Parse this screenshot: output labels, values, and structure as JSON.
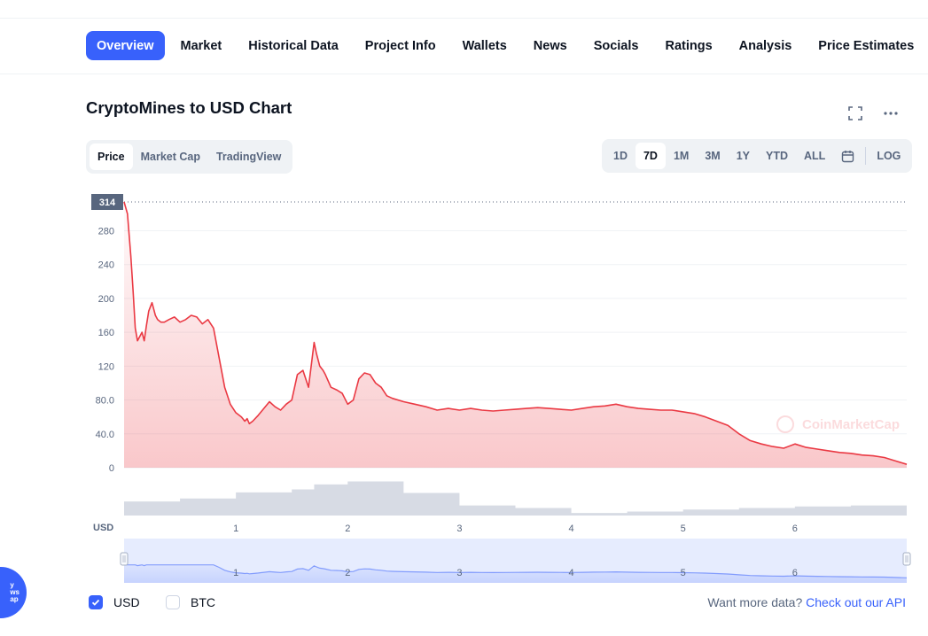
{
  "nav": {
    "tabs": [
      {
        "label": "Overview",
        "active": true
      },
      {
        "label": "Market"
      },
      {
        "label": "Historical Data"
      },
      {
        "label": "Project Info"
      },
      {
        "label": "Wallets"
      },
      {
        "label": "News"
      },
      {
        "label": "Socials"
      },
      {
        "label": "Ratings"
      },
      {
        "label": "Analysis"
      },
      {
        "label": "Price Estimates"
      }
    ]
  },
  "chart_header": {
    "title": "CryptoMines to USD Chart",
    "fullscreen_icon": "fullscreen-icon",
    "more_icon": "more-icon"
  },
  "chart_type_tabs": [
    {
      "label": "Price",
      "active": true
    },
    {
      "label": "Market Cap"
    },
    {
      "label": "TradingView"
    }
  ],
  "range_tabs": [
    {
      "label": "1D"
    },
    {
      "label": "7D",
      "active": true
    },
    {
      "label": "1M"
    },
    {
      "label": "3M"
    },
    {
      "label": "1Y"
    },
    {
      "label": "YTD"
    },
    {
      "label": "ALL"
    }
  ],
  "calendar_icon": "calendar-icon",
  "log_label": "LOG",
  "watermark": "CoinMarketCap",
  "colors": {
    "accent": "#3861fb",
    "price_line": "#ea3943",
    "volume": "#cfd6e4",
    "text_muted": "#58667e"
  },
  "chart_data": {
    "type": "line",
    "currency_label": "USD",
    "current_price_tag": "314",
    "ylim": [
      0,
      314
    ],
    "yticks": [
      0,
      40,
      80,
      120,
      160,
      200,
      240,
      280
    ],
    "ytick_labels": [
      "0",
      "40.0",
      "80.0",
      "120",
      "160",
      "200",
      "240",
      "280"
    ],
    "xlim": [
      0,
      7
    ],
    "xticks": [
      1,
      2,
      3,
      4,
      5,
      6
    ],
    "xtick_labels": [
      "1",
      "2",
      "3",
      "4",
      "5",
      "6"
    ],
    "series": [
      {
        "type": "line",
        "x": [
          0,
          0.03,
          0.06,
          0.08,
          0.1,
          0.12,
          0.14,
          0.16,
          0.18,
          0.2,
          0.22,
          0.25,
          0.28,
          0.3,
          0.33,
          0.36,
          0.4,
          0.45,
          0.5,
          0.55,
          0.6,
          0.65,
          0.7,
          0.75,
          0.8,
          0.85,
          0.9,
          0.95,
          1.0,
          1.05,
          1.08,
          1.1,
          1.12,
          1.15,
          1.2,
          1.25,
          1.3,
          1.35,
          1.4,
          1.45,
          1.5,
          1.55,
          1.6,
          1.65,
          1.7,
          1.72,
          1.75,
          1.78,
          1.8,
          1.85,
          1.9,
          1.95,
          2.0,
          2.05,
          2.1,
          2.15,
          2.2,
          2.25,
          2.3,
          2.35,
          2.4,
          2.5,
          2.6,
          2.7,
          2.8,
          2.9,
          3.0,
          3.1,
          3.2,
          3.3,
          3.4,
          3.5,
          3.6,
          3.7,
          3.8,
          3.9,
          4.0,
          4.1,
          4.2,
          4.3,
          4.4,
          4.5,
          4.6,
          4.7,
          4.8,
          4.9,
          5.0,
          5.1,
          5.2,
          5.3,
          5.4,
          5.5,
          5.6,
          5.7,
          5.8,
          5.9,
          6.0,
          6.1,
          6.2,
          6.3,
          6.4,
          6.5,
          6.6,
          6.7,
          6.8,
          6.9,
          7.0
        ],
        "y": [
          314,
          300,
          250,
          210,
          165,
          150,
          155,
          160,
          150,
          168,
          185,
          195,
          180,
          175,
          172,
          172,
          175,
          178,
          172,
          175,
          180,
          178,
          170,
          175,
          165,
          130,
          95,
          75,
          65,
          60,
          55,
          58,
          52,
          55,
          62,
          70,
          78,
          72,
          68,
          75,
          80,
          110,
          115,
          95,
          148,
          135,
          120,
          115,
          110,
          95,
          92,
          88,
          75,
          80,
          105,
          112,
          110,
          100,
          95,
          85,
          82,
          78,
          75,
          72,
          68,
          70,
          68,
          70,
          68,
          67,
          68,
          69,
          70,
          71,
          70,
          69,
          68,
          70,
          72,
          73,
          75,
          72,
          70,
          69,
          68,
          68,
          66,
          64,
          60,
          55,
          50,
          40,
          32,
          28,
          25,
          23,
          28,
          24,
          22,
          20,
          18,
          17,
          15,
          14,
          12,
          8,
          4
        ]
      }
    ],
    "volume": {
      "x": [
        0,
        0.5,
        1.0,
        1.5,
        1.7,
        2.0,
        2.5,
        3.0,
        3.5,
        4.0,
        4.5,
        5.0,
        5.5,
        6.0,
        6.5,
        7.0
      ],
      "values": [
        0.28,
        0.34,
        0.46,
        0.52,
        0.62,
        0.68,
        0.45,
        0.2,
        0.15,
        0.05,
        0.08,
        0.12,
        0.15,
        0.18,
        0.2,
        0.22
      ]
    }
  },
  "legend": {
    "items": [
      {
        "label": "USD",
        "checked": true
      },
      {
        "label": "BTC",
        "checked": false
      }
    ]
  },
  "api": {
    "prefix": "Want more data?",
    "link": "Check out our API"
  },
  "floating_widget": "y\nws\nap"
}
